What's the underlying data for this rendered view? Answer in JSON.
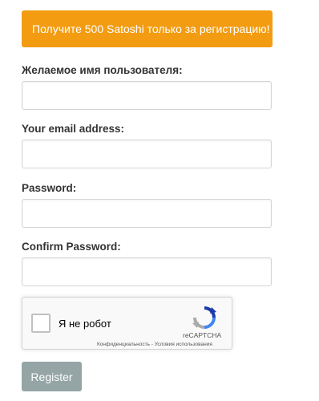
{
  "promo": {
    "text": "Получите 500 Satoshi только за регистрацию!",
    "color": "#f39c12"
  },
  "form": {
    "username_label": "Желаемое имя пользователя:",
    "username_value": "",
    "email_label": "Your email address:",
    "email_value": "",
    "password_label": "Password:",
    "password_value": "",
    "confirm_label": "Confirm Password:",
    "confirm_value": ""
  },
  "captcha": {
    "label": "Я не робот",
    "brand": "reCAPTCHA",
    "privacy_link": "Конфиденциальность",
    "separator": " - ",
    "terms_link": "Условия использования",
    "checked": false,
    "icon": "recaptcha-logo-icon"
  },
  "actions": {
    "register_label": "Register",
    "register_color": "#95a5a6"
  }
}
